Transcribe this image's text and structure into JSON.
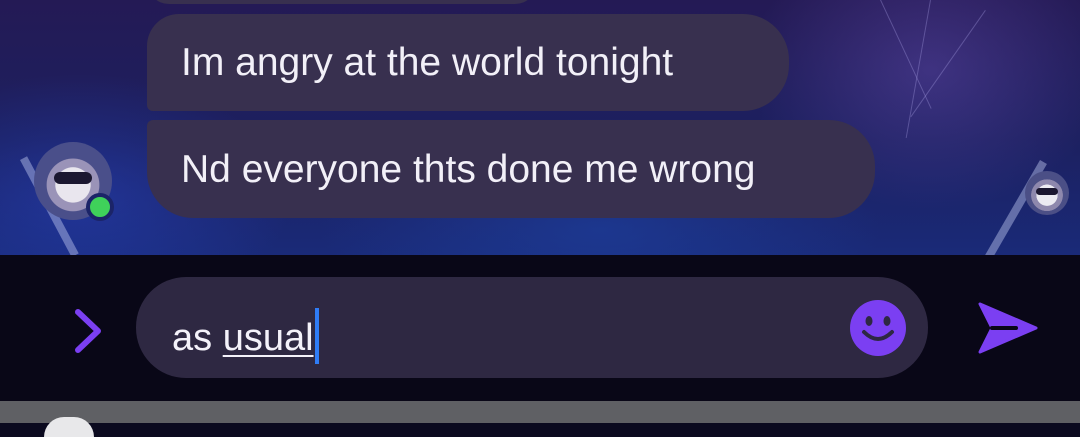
{
  "messages": [
    {
      "text": ""
    },
    {
      "text": "Im angry at the world tonight"
    },
    {
      "text": "Nd everyone thts done me wrong"
    }
  ],
  "composer": {
    "text_prefix": "as ",
    "typed_word": "usual",
    "expand_icon": "chevron-right-icon",
    "emoji_icon": "smiley-icon",
    "send_icon": "send-icon"
  },
  "colors": {
    "bubble": "#38304f",
    "input_pill": "#2e2842",
    "accent_purple": "#7b3ff2",
    "caret": "#2f7cf6",
    "online_status": "#3fd15a"
  },
  "presence": {
    "sender_online": true
  }
}
